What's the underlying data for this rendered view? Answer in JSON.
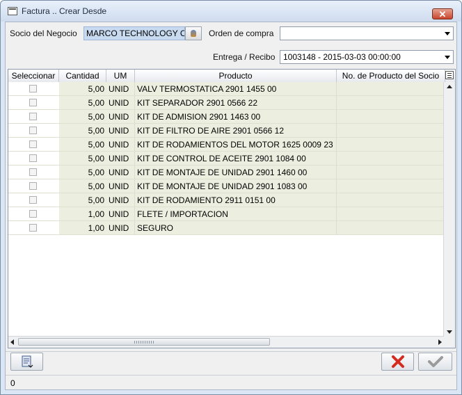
{
  "window": {
    "title": "Factura .. Crear Desde",
    "close_label": "✕"
  },
  "form": {
    "business_partner_label": "Socio del Negocio",
    "business_partner_value": "MARCO TECHNOLOGY CO",
    "purchase_order_label": "Orden de compra",
    "purchase_order_value": "",
    "receipt_label": "Entrega / Recibo",
    "receipt_value": "1003148 - 2015-03-03 00:00:00"
  },
  "table": {
    "columns": [
      "Seleccionar",
      "Cantidad",
      "UM",
      "Producto",
      "No. de Producto del Socio"
    ],
    "rows": [
      {
        "qty": "5,00",
        "um": "UNID",
        "product": "VALV TERMOSTATICA 2901 1455 00",
        "partner_no": ""
      },
      {
        "qty": "5,00",
        "um": "UNID",
        "product": "KIT SEPARADOR 2901 0566 22",
        "partner_no": ""
      },
      {
        "qty": "5,00",
        "um": "UNID",
        "product": "KIT DE ADMISION 2901 1463 00",
        "partner_no": ""
      },
      {
        "qty": "5,00",
        "um": "UNID",
        "product": "KIT DE FILTRO DE AIRE 2901 0566 12",
        "partner_no": ""
      },
      {
        "qty": "5,00",
        "um": "UNID",
        "product": "KIT DE RODAMIENTOS DEL MOTOR 1625 0009 23",
        "partner_no": ""
      },
      {
        "qty": "5,00",
        "um": "UNID",
        "product": "KIT DE CONTROL DE ACEITE 2901 1084 00",
        "partner_no": ""
      },
      {
        "qty": "5,00",
        "um": "UNID",
        "product": "KIT DE MONTAJE DE UNIDAD 2901 1460 00",
        "partner_no": ""
      },
      {
        "qty": "5,00",
        "um": "UNID",
        "product": "KIT DE MONTAJE DE UNIDAD 2901 1083 00",
        "partner_no": ""
      },
      {
        "qty": "5,00",
        "um": "UNID",
        "product": "KIT DE RODAMIENTO 2911 0151 00",
        "partner_no": ""
      },
      {
        "qty": "1,00",
        "um": "UNID",
        "product": "FLETE / IMPORTACION",
        "partner_no": ""
      },
      {
        "qty": "1,00",
        "um": "UNID",
        "product": "SEGURO",
        "partner_no": ""
      }
    ]
  },
  "icons": {
    "bp_lookup": "person-lookup-icon",
    "report": "report-icon",
    "cancel": "cancel-x-icon",
    "ok": "checkmark-icon"
  },
  "colors": {
    "cancel_red": "#d42b1e",
    "ok_gray": "#9a9a9a"
  },
  "status": {
    "text": "0"
  }
}
